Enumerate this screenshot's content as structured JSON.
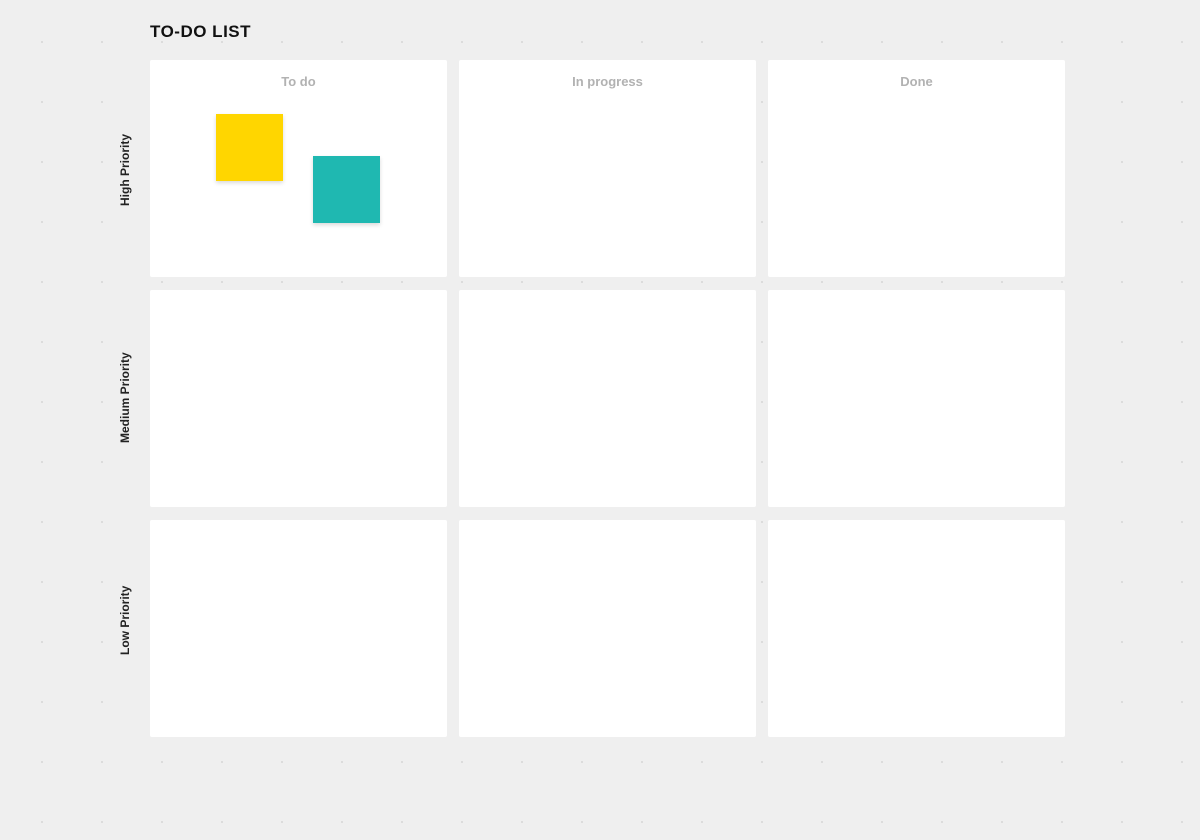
{
  "board": {
    "title": "TO-DO LIST",
    "columns": [
      "To do",
      "In progress",
      "Done"
    ],
    "rows": [
      "High Priority",
      "Medium Priority",
      "Low Priority"
    ]
  },
  "stickies": [
    {
      "id": "sticky-1",
      "color": "#ffd600"
    },
    {
      "id": "sticky-2",
      "color": "#1fb8b1"
    }
  ]
}
